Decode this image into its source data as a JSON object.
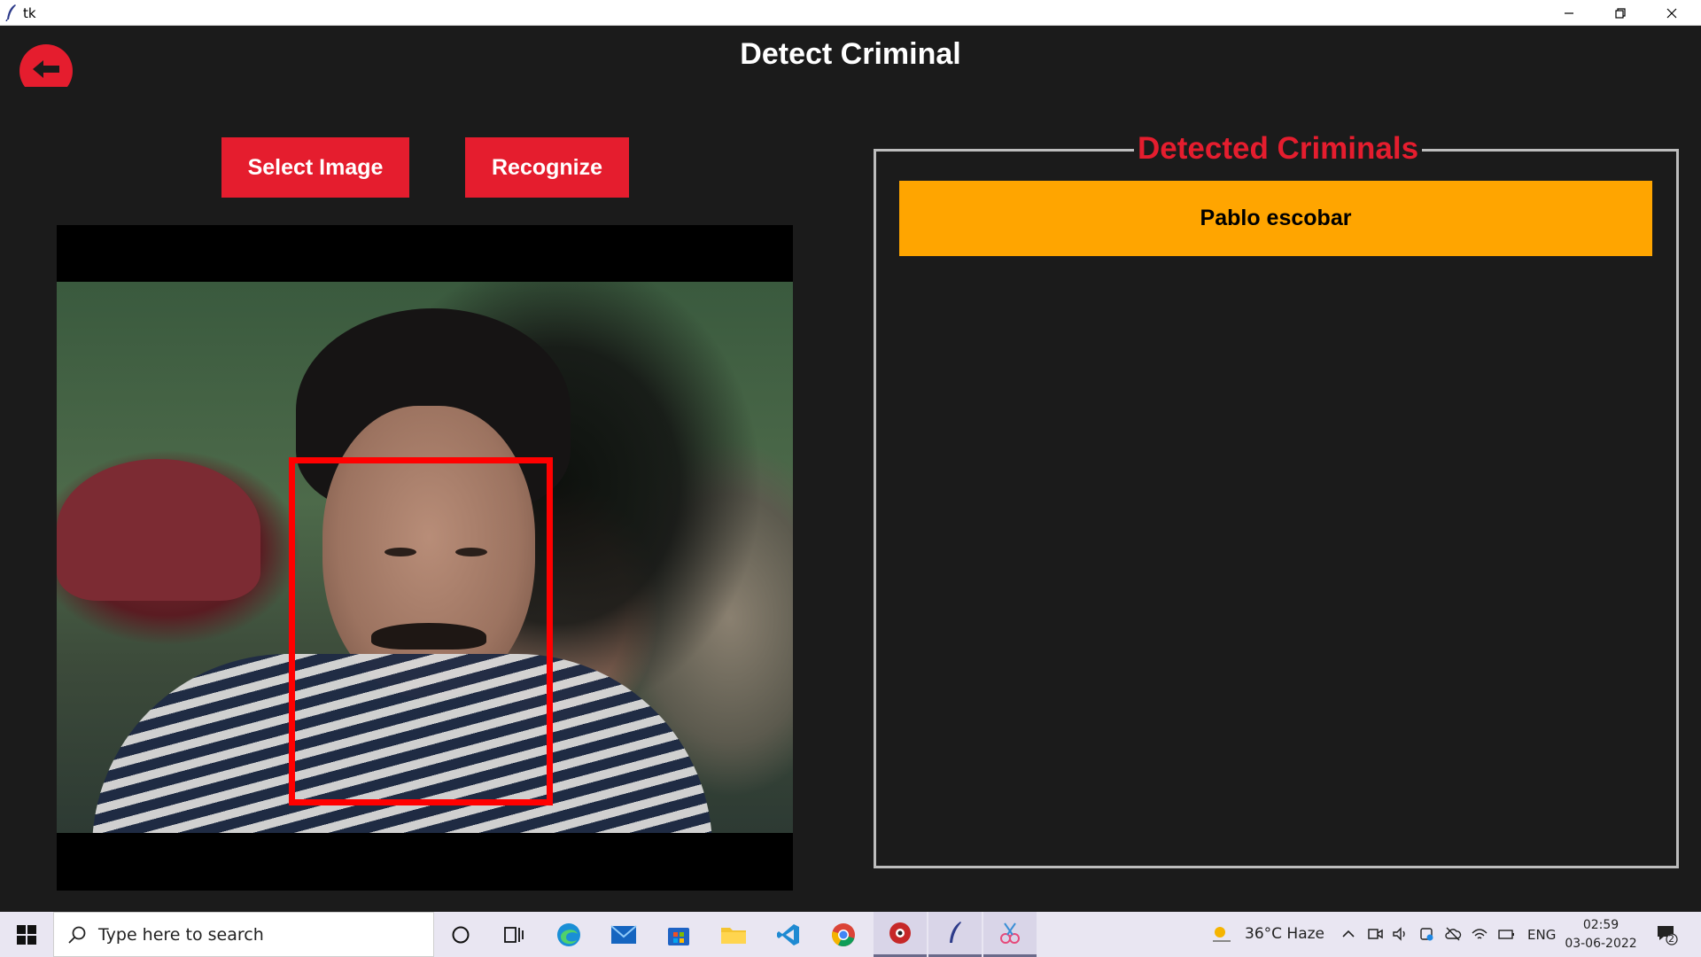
{
  "window": {
    "title": "tk"
  },
  "app": {
    "title": "Detect Criminal",
    "select_image_label": "Select Image",
    "recognize_label": "Recognize",
    "results_label": "Detected Criminals",
    "detected": [
      "Pablo escobar"
    ]
  },
  "colors": {
    "background": "#1b1b1b",
    "accent_red": "#e51d2e",
    "result_bg": "#ffa500",
    "face_box": "#ff0000"
  },
  "taskbar": {
    "search_placeholder": "Type here to search",
    "weather": "36°C  Haze",
    "language": "ENG",
    "time": "02:59",
    "date": "03-06-2022",
    "notification_count": "2"
  }
}
